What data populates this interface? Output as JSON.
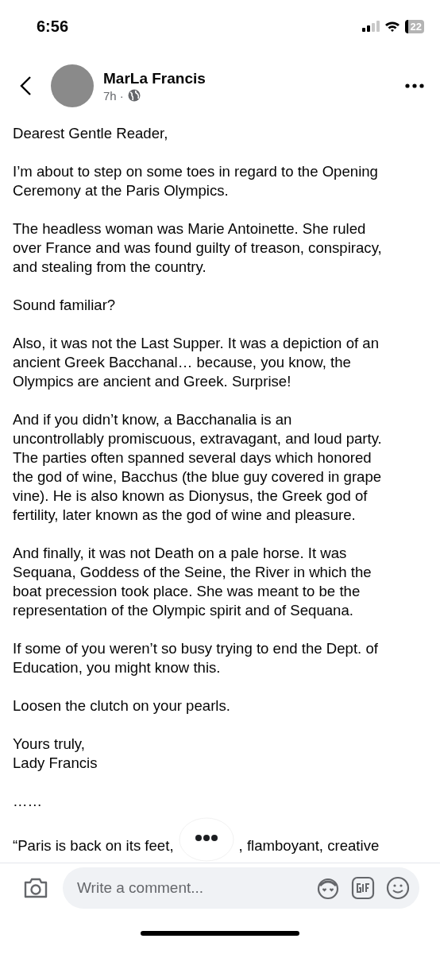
{
  "status_bar": {
    "time": "6:56",
    "battery": "22"
  },
  "post": {
    "author": "MarLa Francis",
    "time": "7h ·"
  },
  "paragraphs": [
    "Dearest Gentle Reader,",
    "I’m about to step on some toes in regard to the Opening\nCeremony at the Paris Olympics.",
    "The headless woman was Marie Antoinette. She ruled\nover France and was found guilty of treason, conspiracy,\nand stealing from the country.",
    "Sound familiar?",
    "Also, it was not the Last Supper. It was a depiction of an\nancient Greek Bacchanal… because, you know, the\nOlympics are ancient and Greek. Surprise!",
    "And if you didn’t know, a Bacchanalia is an\nuncontrollably promiscuous, extravagant, and loud party.\nThe parties often spanned several days which honored\nthe god of wine, Bacchus (the blue guy covered in grape\nvine). He is also known as Dionysus, the Greek god of\nfertility, later known as the god of wine and pleasure.",
    "And finally, it was not Death on a pale horse. It was\nSequana, Goddess of the Seine, the River in which the\nboat precession took place. She was meant to be the\nrepresentation of the Olympic spirit and of Sequana.",
    "If some of you weren’t so busy trying to end the Dept. of\nEducation, you might know this.",
    "Loosen the clutch on your pearls.",
    "Yours truly,\nLady Francis",
    "……"
  ],
  "quote_parts": [
    "“Paris is back on its feet,",
    ", flamboyant, creative"
  ],
  "comment_bar": {
    "placeholder": "Write a comment..."
  }
}
